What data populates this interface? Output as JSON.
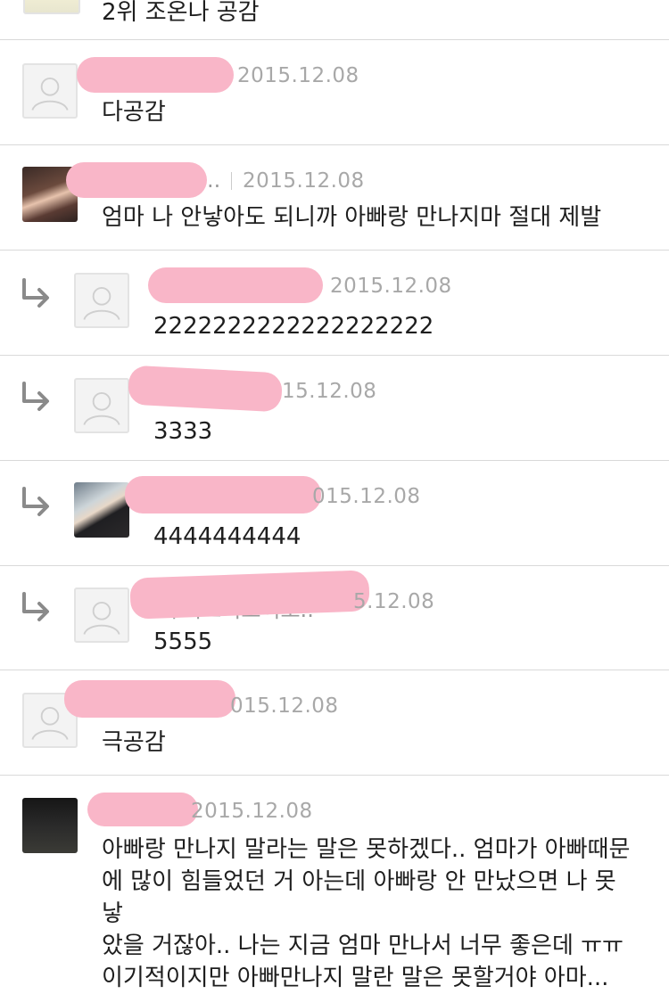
{
  "comments": [
    {
      "text": "2위 조온나 공감"
    },
    {
      "date": "2015.12.08",
      "text": "다공감"
    },
    {
      "nick_tail": "..",
      "date": "2015.12.08",
      "text": "엄마 나 안낳아도 되니까 아빠랑 만나지마 절대 제발"
    },
    {
      "date": "2015.12.08",
      "text": "2222222222222222222"
    },
    {
      "date": "15.12.08",
      "text": "3333"
    },
    {
      "date": "015.12.08",
      "text": "4444444444"
    },
    {
      "nick_tail": "ㅓ이오이오이오..",
      "date": "5.12.08",
      "text": "5555"
    },
    {
      "date": "015.12.08",
      "text": "극공감"
    },
    {
      "date": "2015.12.08",
      "lines": [
        "아빠랑 만나지 말라는 말은 못하겠다.. 엄마가 아빠때문",
        "에 많이 힘들었던 거 아는데 아빠랑 안 만났으면 나 못 낳",
        "았을 거잖아.. 나는 지금 엄마 만나서 너무 좋은데 ㅠㅠ",
        "이기적이지만 아빠만나지 말란 말은 못할거야 아마..."
      ]
    }
  ],
  "icons": {
    "default_avatar": "person-silhouette-icon",
    "reply": "reply-arrow-icon"
  },
  "colors": {
    "nickname_redaction": "#f9b6c8",
    "date_text": "#a8a8a8",
    "divider": "#d9d9d9"
  }
}
